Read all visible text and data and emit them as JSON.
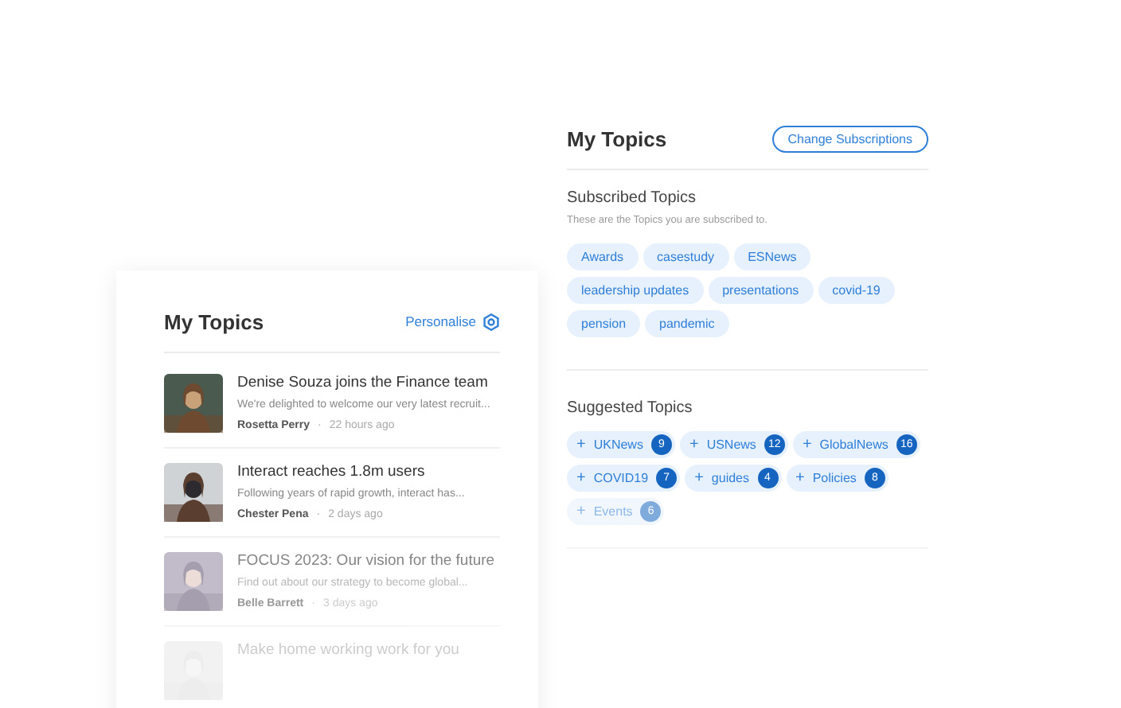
{
  "topics_card": {
    "title": "My Topics",
    "button": "Change Subscriptions",
    "subscribed": {
      "heading": "Subscribed Topics",
      "description": "These are the Topics you are subscribed to.",
      "tags": [
        "Awards",
        "casestudy",
        "ESNews",
        "leadership updates",
        "presentations",
        "covid-19",
        "pension",
        "pandemic"
      ]
    },
    "suggested": {
      "heading": "Suggested Topics",
      "tags": [
        {
          "icon": "+",
          "label": "UKNews",
          "count": "9"
        },
        {
          "icon": "+",
          "label": "USNews",
          "count": "12"
        },
        {
          "icon": "+",
          "label": "GlobalNews",
          "count": "16"
        },
        {
          "icon": "+",
          "label": "COVID19",
          "count": "7"
        },
        {
          "icon": "+",
          "label": "guides",
          "count": "4"
        },
        {
          "icon": "+",
          "label": "Policies",
          "count": "8"
        },
        {
          "icon": "+",
          "label": "Events",
          "count": "6"
        }
      ]
    }
  },
  "feed_card": {
    "title": "My Topics",
    "link": "Personalise",
    "articles": [
      {
        "kind": "picture",
        "title": "Denise Souza joins the Finance team",
        "excerpt": "We're delighted to welcome our very latest recruit...",
        "author": "Rosetta Perry",
        "separator": "·",
        "time": "22 hours ago"
      },
      {
        "kind": "picture",
        "title": "Interact reaches 1.8m users",
        "excerpt": "Following years of rapid growth, interact has...",
        "author": "Chester Pena",
        "separator": "·",
        "time": "2 days ago"
      },
      {
        "kind": "picture",
        "title": "FOCUS 2023: Our vision for the future",
        "excerpt": "Find out about our strategy to become global...",
        "author": "Belle Barrett",
        "separator": "·",
        "time": "3 days ago"
      },
      {
        "kind": "picture",
        "title": "Make home working work for you"
      }
    ]
  }
}
